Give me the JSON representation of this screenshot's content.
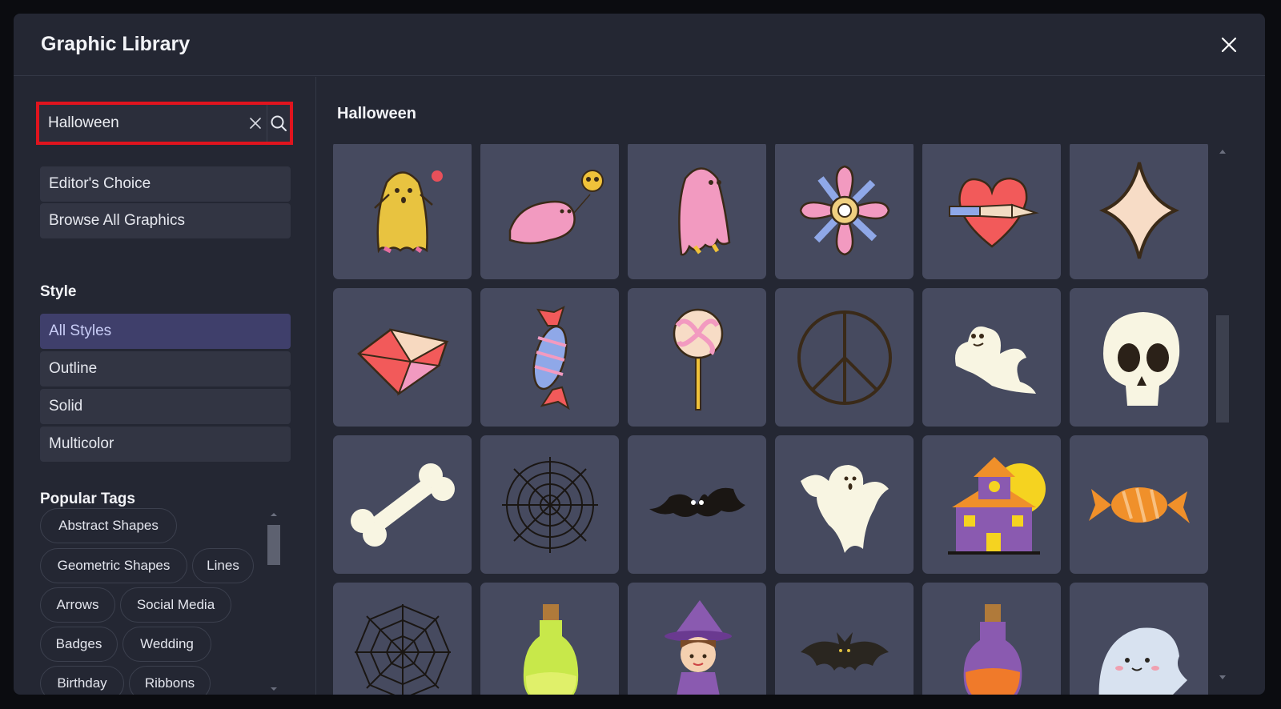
{
  "modal": {
    "title": "Graphic Library"
  },
  "search": {
    "value": "Halloween",
    "placeholder": ""
  },
  "nav": {
    "editors_choice": "Editor's Choice",
    "browse_all": "Browse All Graphics"
  },
  "style": {
    "heading": "Style",
    "options": [
      "All Styles",
      "Outline",
      "Solid",
      "Multicolor"
    ],
    "selected": "All Styles"
  },
  "popular_tags": {
    "heading": "Popular Tags",
    "tags": [
      "Abstract Shapes",
      "Geometric Shapes",
      "Lines",
      "Arrows",
      "Social Media",
      "Badges",
      "Wedding",
      "Birthday",
      "Ribbons"
    ]
  },
  "results": {
    "title": "Halloween",
    "graphics": [
      "ghost-icon",
      "flying-ghost-icon",
      "pink-ghost-icon",
      "flower-icon",
      "heart-knife-icon",
      "sparkle-icon",
      "gem-icon",
      "candy-icon",
      "lollipop-icon",
      "peace-icon",
      "ghost-icon",
      "skull-icon",
      "bone-icon",
      "spider-web-icon",
      "bat-icon",
      "ghost-icon",
      "haunted-house-icon",
      "candy-icon",
      "spider-web-icon",
      "potion-bottle-icon",
      "witch-icon",
      "bat-icon",
      "potion-bottle-icon",
      "ghost-icon"
    ]
  },
  "colors": {
    "highlight": "#e0141e",
    "selected_style_bg": "#3f3f6b",
    "tile_bg": "#464a5f",
    "modal_bg": "#242733"
  }
}
